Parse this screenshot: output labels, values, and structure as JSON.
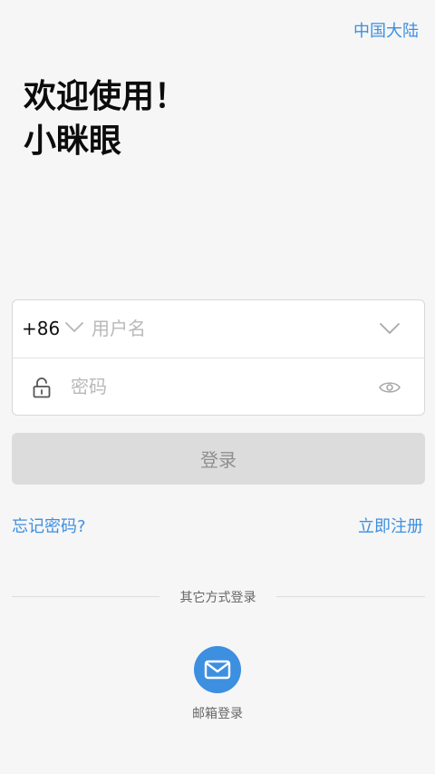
{
  "header": {
    "region_label": "中国大陆"
  },
  "welcome": {
    "line1": "欢迎使用！",
    "line2": "小眯眼"
  },
  "form": {
    "country_code": "+86",
    "username_placeholder": "用户名",
    "username_value": "",
    "password_placeholder": "密码",
    "password_value": ""
  },
  "actions": {
    "login_label": "登录",
    "forgot_label": "忘记密码?",
    "register_label": "立即注册"
  },
  "other_login": {
    "divider_label": "其它方式登录",
    "email_label": "邮箱登录"
  },
  "icons": {
    "code_dropdown": "chevron-down-icon",
    "account_dropdown": "chevron-down-icon",
    "lock": "lock-icon",
    "visibility": "eye-icon",
    "email": "mail-icon"
  },
  "colors": {
    "accent": "#3d8fe0",
    "button_disabled_bg": "#dcdcdc",
    "button_disabled_text": "#8f8f8f",
    "background": "#f6f6f6"
  }
}
